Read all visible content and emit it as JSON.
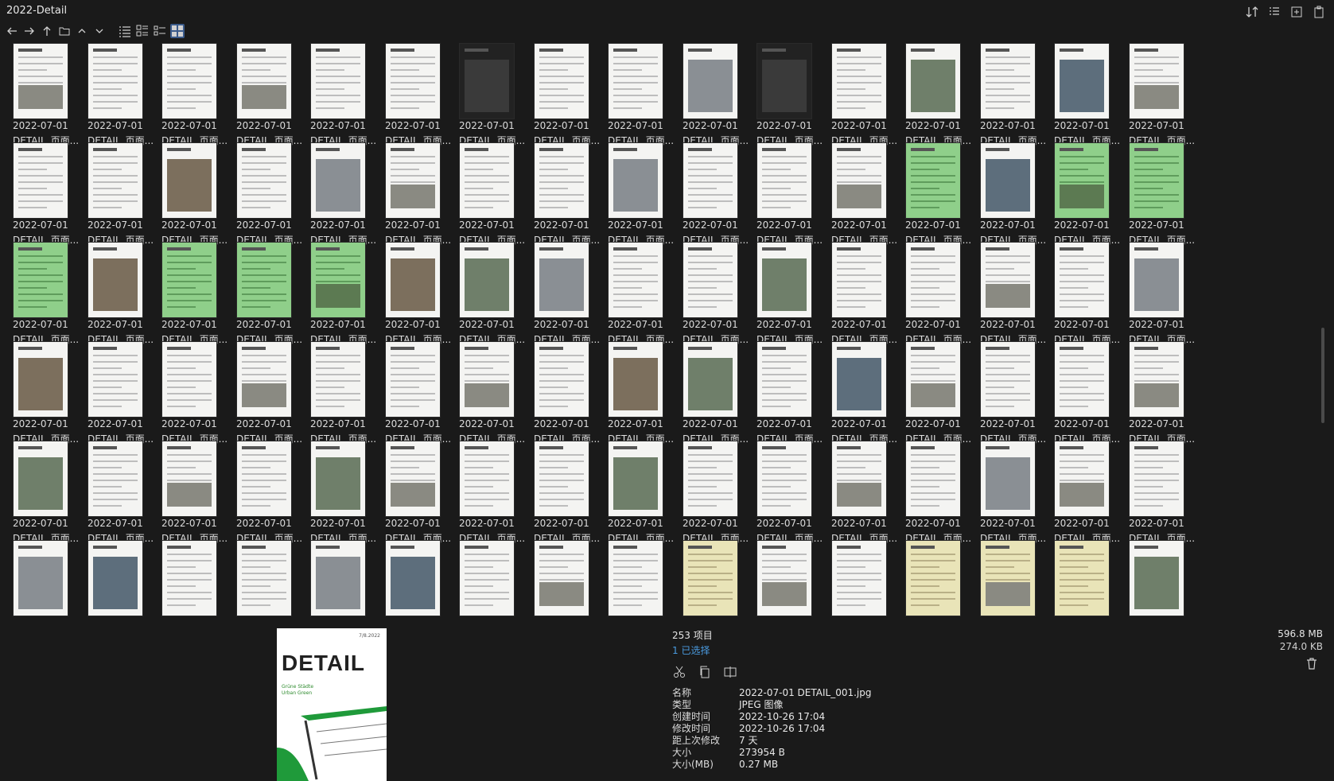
{
  "window": {
    "title": "2022-Detail"
  },
  "toolbar": {
    "buttons": [
      "back-icon",
      "forward-icon",
      "up-icon",
      "folder-icon",
      "sort-up-icon",
      "sort-down-icon",
      "list-view-icon",
      "detail-view-icon",
      "compact-view-icon",
      "thumbnail-view-icon"
    ]
  },
  "grid": {
    "date_label": "2022-07-01",
    "name_label": "DETAIL_页面...",
    "themes": [
      [
        "w",
        "w",
        "w",
        "w",
        "w",
        "w",
        "dark",
        "w",
        "w",
        "photo",
        "dark",
        "w",
        "photo",
        "w",
        "photo",
        "w"
      ],
      [
        "w",
        "w",
        "photo",
        "w",
        "photo",
        "w",
        "w",
        "w",
        "photo",
        "w",
        "w",
        "w",
        "green",
        "photo",
        "green",
        "green"
      ],
      [
        "green",
        "photo",
        "green",
        "green",
        "green",
        "photo",
        "photo",
        "photo",
        "w",
        "w",
        "photo",
        "w",
        "w",
        "w",
        "w",
        "photo"
      ],
      [
        "photo",
        "w",
        "w",
        "w",
        "w",
        "w",
        "w",
        "w",
        "photo",
        "photo",
        "w",
        "photo",
        "w",
        "w",
        "w",
        "w"
      ],
      [
        "photo",
        "w",
        "w",
        "w",
        "photo",
        "w",
        "w",
        "w",
        "photo",
        "w",
        "w",
        "w",
        "w",
        "photo",
        "w",
        "w"
      ],
      [
        "photo",
        "photo",
        "w",
        "w",
        "photo",
        "photo",
        "w",
        "w",
        "w",
        "yellow",
        "w",
        "w",
        "yellow",
        "yellow",
        "yellow",
        "photo"
      ]
    ]
  },
  "status": {
    "count": "253 项目",
    "selected": "1 已选择",
    "total_size": "596.8 MB",
    "selected_size": "274.0 KB"
  },
  "preview": {
    "logo": "DETAIL",
    "issue": "7/8.2022",
    "subtitle_de": "Grüne Städte",
    "subtitle_en": "Urban Green"
  },
  "properties": [
    {
      "key": "名称",
      "value": "2022-07-01 DETAIL_001.jpg"
    },
    {
      "key": "类型",
      "value": "JPEG 图像"
    },
    {
      "key": "创建时间",
      "value": "2022-10-26  17:04"
    },
    {
      "key": "修改时间",
      "value": "2022-10-26  17:04"
    },
    {
      "key": "距上次修改",
      "value": "7 天"
    },
    {
      "key": "大小",
      "value": "273954 B"
    },
    {
      "key": "大小(MB)",
      "value": "0.27 MB"
    }
  ]
}
